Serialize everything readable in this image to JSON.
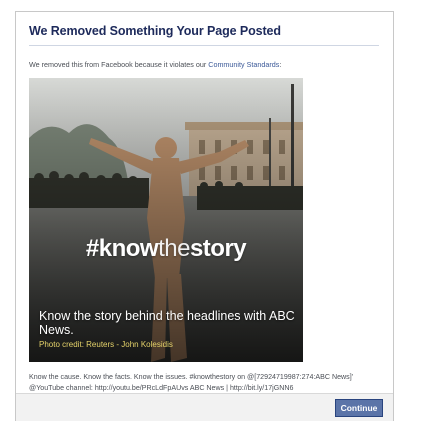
{
  "dialog": {
    "title": "We Removed Something Your Page Posted",
    "notice_text": "We removed this from Facebook because it violates our ",
    "notice_link": "Community Standards",
    "notice_suffix": ":",
    "image": {
      "hashtag_bold": "#know",
      "hashtag_light": "the",
      "hashtag_end": "story",
      "headline": "Know the story behind the headlines with ABC News.",
      "credit": "Photo credit: Reuters - John Kolesidis"
    },
    "caption_line1": "Know the cause. Know the facts. Know the issues. #knowthestory on @[72924719987:274:ABC News]'",
    "caption_line2": "@YouTube channel: http://youtu.be/PRcLdFpAUvs ABC News | http://bit.ly/17jGNN6",
    "continue_label": "Continue"
  }
}
